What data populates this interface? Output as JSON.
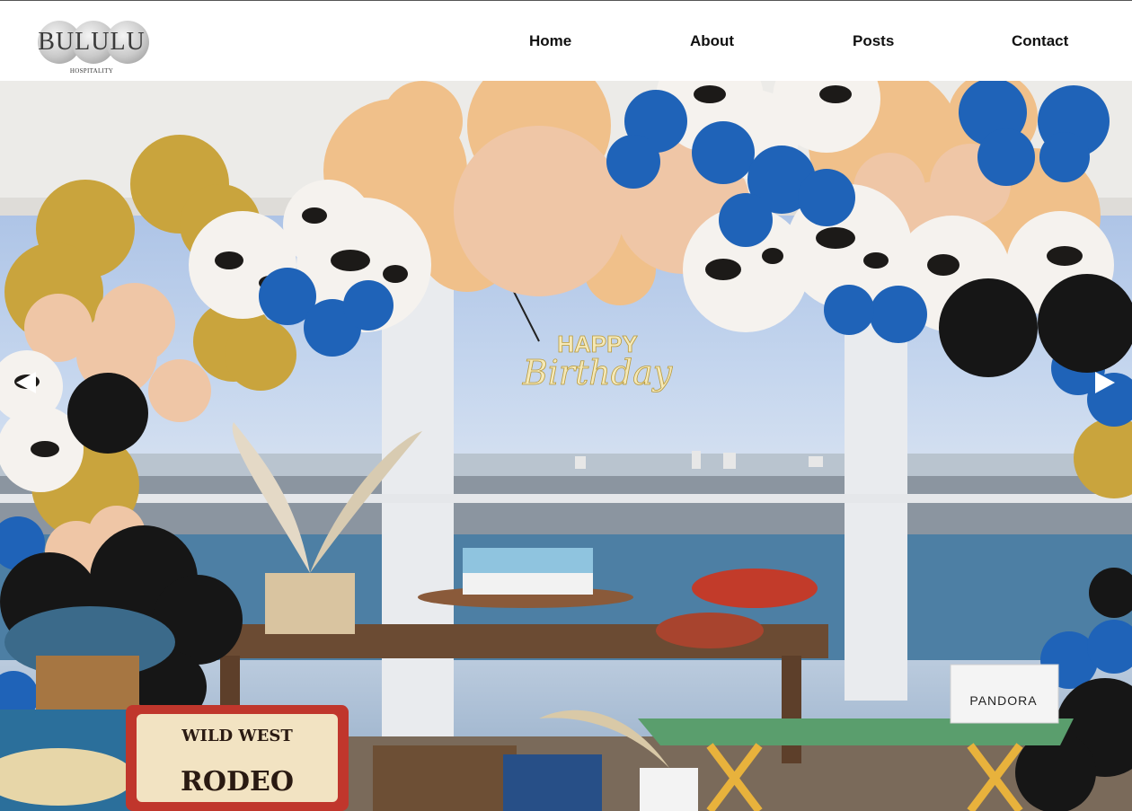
{
  "brand": {
    "name": "BULULU",
    "tagline": "HOSPITALITY"
  },
  "nav": {
    "items": [
      {
        "label": "Home"
      },
      {
        "label": "About"
      },
      {
        "label": "Posts"
      },
      {
        "label": "Contact"
      }
    ]
  },
  "hero": {
    "sign_line1": "HAPPY",
    "sign_line2": "Birthday",
    "banner_line1": "WILD WEST",
    "banner_line2": "RODEO",
    "bag_label": "PANDORA",
    "prev_icon": "chevron-left-icon",
    "next_icon": "chevron-right-icon"
  },
  "colors": {
    "nav_text": "#111111",
    "header_bg": "#ffffff",
    "arrow": "#ffffff"
  }
}
